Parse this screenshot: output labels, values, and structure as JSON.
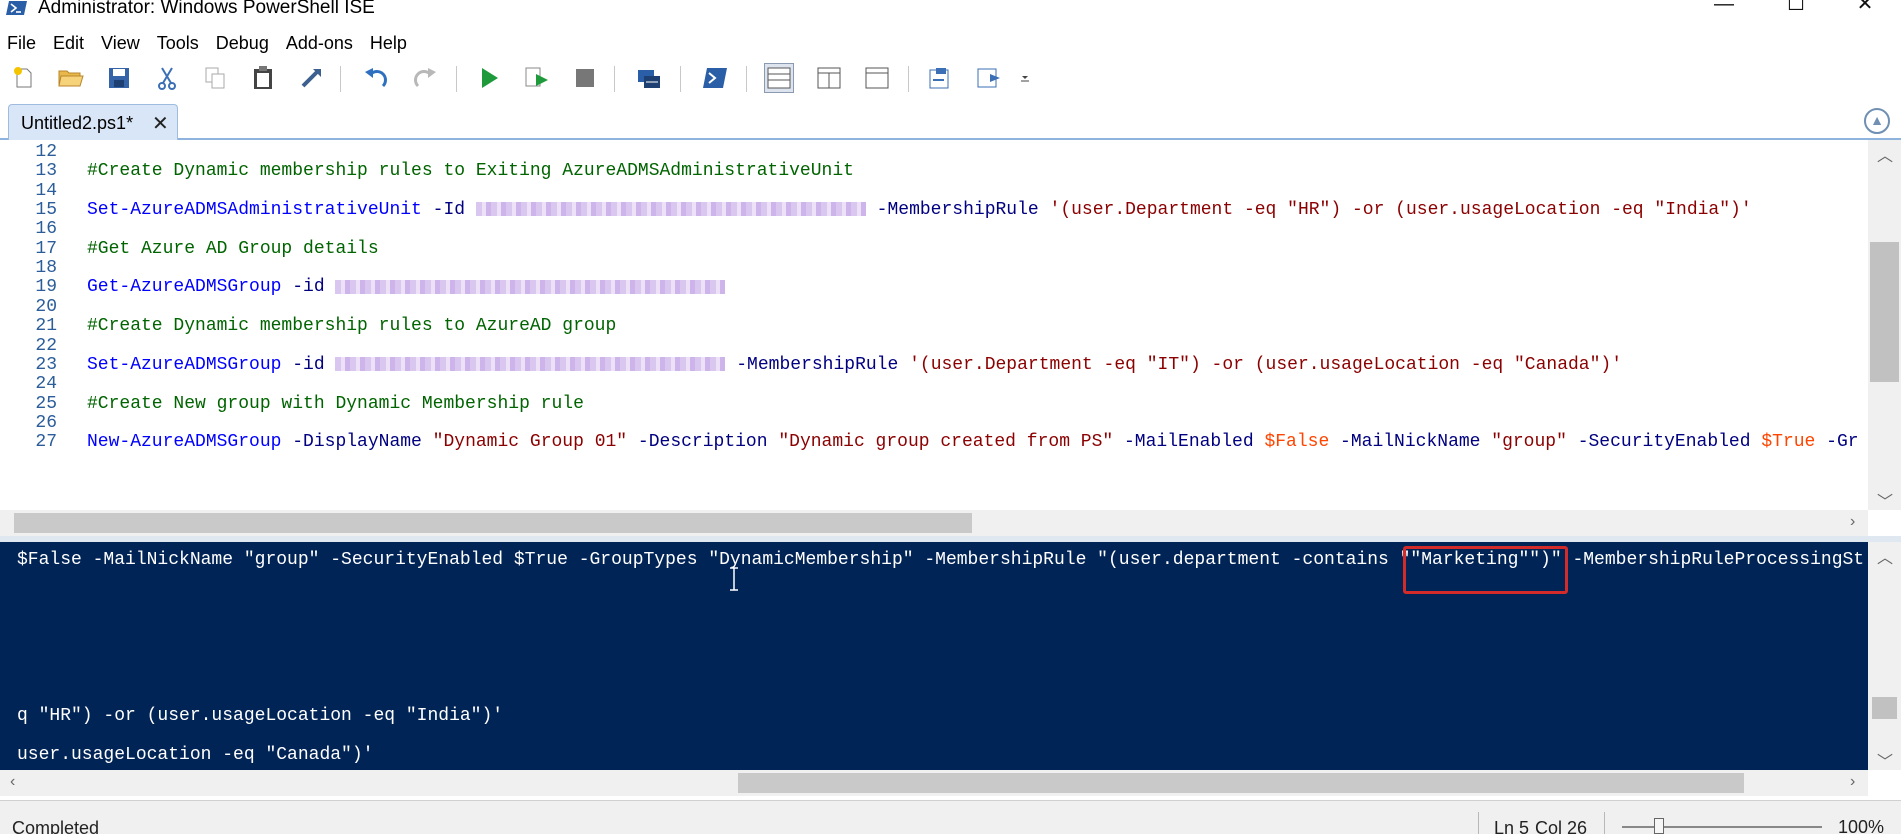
{
  "window": {
    "title": "Administrator: Windows PowerShell ISE",
    "minimize": "—",
    "maximize": "☐",
    "close": "✕"
  },
  "menu": [
    "File",
    "Edit",
    "View",
    "Tools",
    "Debug",
    "Add-ons",
    "Help"
  ],
  "toolbar": {
    "buttons": [
      "new-script",
      "open",
      "save",
      "cut",
      "copy",
      "paste",
      "clear-console",
      "undo",
      "redo",
      "run-script",
      "run-selection",
      "stop",
      "new-remote-tab",
      "start-powershell",
      "show-script-top",
      "show-script-right",
      "show-script-maximized",
      "show-command-window",
      "show-command-addon"
    ]
  },
  "tab": {
    "label": "Untitled2.ps1*",
    "close": "✕"
  },
  "editor": {
    "lines": [
      {
        "n": "12",
        "parts": []
      },
      {
        "n": "13",
        "parts": [
          {
            "t": "#Create Dynamic membership rules to Exiting AzureADMSAdministrativeUnit",
            "c": "cmt"
          }
        ]
      },
      {
        "n": "14",
        "parts": []
      },
      {
        "n": "15",
        "parts": [
          {
            "t": "Set-AzureADMSAdministrativeUnit",
            "c": "cmd"
          },
          {
            "t": " -Id ",
            "c": "param"
          },
          {
            "blur": 390
          },
          {
            "t": " -MembershipRule ",
            "c": "param"
          },
          {
            "t": "'(user.Department -eq \"HR\") -or (user.usageLocation -eq \"India\")'",
            "c": "str"
          }
        ]
      },
      {
        "n": "16",
        "parts": []
      },
      {
        "n": "17",
        "parts": [
          {
            "t": "#Get Azure AD Group details",
            "c": "cmt"
          }
        ]
      },
      {
        "n": "18",
        "parts": []
      },
      {
        "n": "19",
        "parts": [
          {
            "t": "Get-AzureADMSGroup",
            "c": "cmd"
          },
          {
            "t": " -id ",
            "c": "param"
          },
          {
            "blur": 390
          }
        ]
      },
      {
        "n": "20",
        "parts": []
      },
      {
        "n": "21",
        "parts": [
          {
            "t": "#Create Dynamic membership rules to AzureAD group",
            "c": "cmt"
          }
        ]
      },
      {
        "n": "22",
        "parts": []
      },
      {
        "n": "23",
        "parts": [
          {
            "t": "Set-AzureADMSGroup",
            "c": "cmd"
          },
          {
            "t": " -id ",
            "c": "param"
          },
          {
            "blur": 390
          },
          {
            "t": " -MembershipRule ",
            "c": "param"
          },
          {
            "t": "'(user.Department -eq \"IT\") -or (user.usageLocation -eq \"Canada\")'",
            "c": "str"
          }
        ]
      },
      {
        "n": "24",
        "parts": []
      },
      {
        "n": "25",
        "parts": [
          {
            "t": "#Create New group with Dynamic Membership rule",
            "c": "cmt"
          }
        ]
      },
      {
        "n": "26",
        "parts": []
      },
      {
        "n": "27",
        "parts": [
          {
            "t": "New-AzureADMSGroup",
            "c": "cmd"
          },
          {
            "t": " -DisplayName ",
            "c": "param"
          },
          {
            "t": "\"Dynamic Group 01\"",
            "c": "str"
          },
          {
            "t": " -Description ",
            "c": "param"
          },
          {
            "t": "\"Dynamic group created from PS\"",
            "c": "str"
          },
          {
            "t": " -MailEnabled ",
            "c": "param"
          },
          {
            "t": "$False",
            "c": "var"
          },
          {
            "t": " -MailNickName ",
            "c": "param"
          },
          {
            "t": "\"group\"",
            "c": "str"
          },
          {
            "t": " -SecurityEnabled ",
            "c": "param"
          },
          {
            "t": "$True",
            "c": "var"
          },
          {
            "t": " -Gr",
            "c": "param"
          }
        ]
      }
    ]
  },
  "console": {
    "lines": [
      "$False -MailNickName \"group\" -SecurityEnabled $True -GroupTypes \"DynamicMembership\" -MembershipRule \"(user.department -contains \"\"Marketing\"\")\" -MembershipRuleProcessingSt",
      "",
      "",
      "",
      "q \"HR\") -or (user.usageLocation -eq \"India\")'",
      "user.usageLocation -eq \"Canada\")'"
    ]
  },
  "status": {
    "text": "Completed",
    "line": "Ln 5",
    "col": "Col 26",
    "zoom": "100%"
  },
  "colors": {
    "console_bg": "#012456",
    "comment": "#006400",
    "cmdlet": "#0000ff",
    "string": "#8b0000",
    "variable": "#ff4500",
    "highlight": "#d32a2a"
  }
}
